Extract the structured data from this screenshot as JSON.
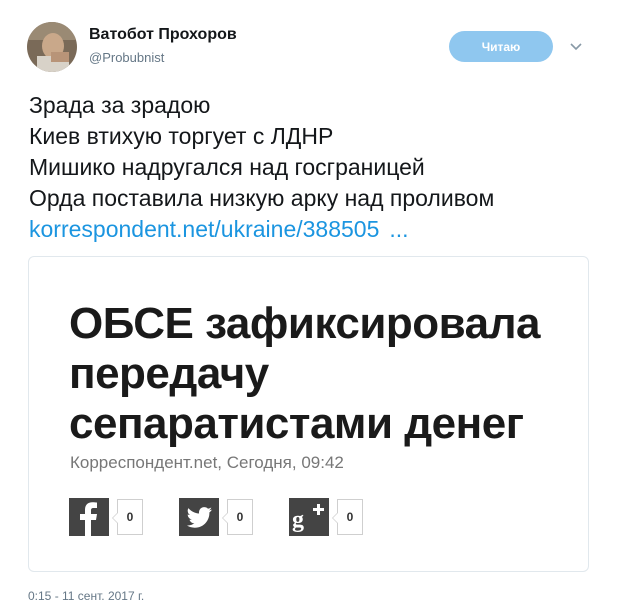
{
  "header": {
    "name": "Ватобот Прохоров",
    "handle": "@Probubnist",
    "follow_label": "Читаю"
  },
  "tweet": {
    "lines": [
      "Зрада за зрадою",
      "Киев втихую торгует с ЛДНР",
      "Мишико надругался над госграницей",
      "Орда поставила низкую арку над проливом"
    ],
    "link": "korrespondent.net/ukraine/388505",
    "link_ellipsis": "..."
  },
  "card": {
    "headline": [
      "ОБСЕ зафиксировала",
      "передачу",
      "сепаратистами денег"
    ],
    "source": "Корреспондент.net, Сегодня, 09:42",
    "shares": {
      "facebook": "0",
      "twitter": "0",
      "googleplus": "0"
    }
  },
  "timestamp": "0:15 - 11 сент. 2017 г.",
  "colors": {
    "link": "#1b95e0",
    "follow_button": "#8fc7ef",
    "share_icon_bg": "#444444"
  }
}
